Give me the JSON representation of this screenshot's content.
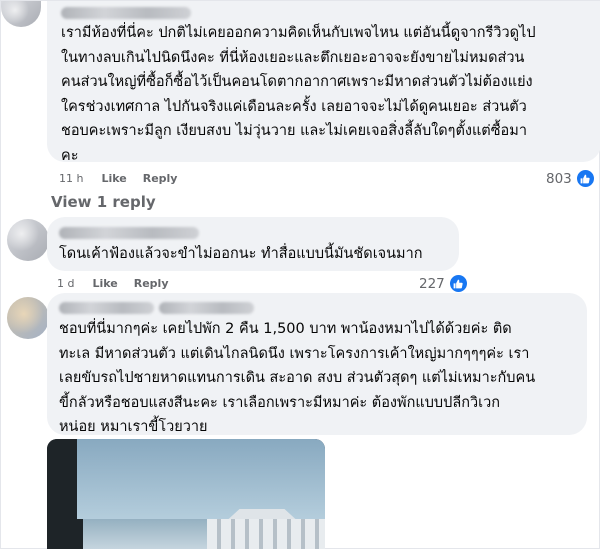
{
  "comments": [
    {
      "text": "เรามีห้องที่นี่คะ ปกติไม่เคยออกความคิดเห็นกับเพจไหน แต่อันนี้ดูจากรีวิวดูไป\nในทางลบเกินไปนิดนึงคะ ที่นี่ห้องเยอะและตึกเยอะอาจจะยังขายไม่หมดส่วน\nคนส่วนใหญ่ที่ซื้อก็ซื้อไว้เป็นคอนโดตากอากาศเพราะมีหาดส่วนตัวไม่ต้องแย่ง\nใครช่วงเทศกาล ไปกันจริงแค่เดือนละครั้ง เลยอาจจะไม่ได้ดูคนเยอะ ส่วนตัว\nชอบคะเพราะมีลูก เงียบสงบ ไม่วุ่นวาย และไม่เคยเจอสิ่งลี้ลับใดๆตั้งแต่ซื้อมา\nคะ",
      "time": "11 h",
      "like_label": "Like",
      "reply_label": "Reply",
      "reactions": "803"
    },
    {
      "text": "โดนเค้าฟ้องแล้วจะขำไม่ออกนะ ทำสื่อแบบนี้มันชัดเจนมาก",
      "time": "1 d",
      "like_label": "Like",
      "reply_label": "Reply",
      "reactions": "227"
    },
    {
      "text": "ชอบที่นี่มากๆค่ะ เคยไปพัก 2 คืน 1,500 บาท พาน้องหมาไปได้ด้วยค่ะ ติด\nทะเล มีหาดส่วนตัว แต่เดินไกลนิดนึง เพราะโครงการเค้าใหญ่มากๆๆๆค่ะ เรา\nเลยขับรถไปชายหาดแทนการเดิน สะอาด สงบ ส่วนตัวสุดๆ แต่ไม่เหมาะกับคน\nขี้กลัวหรือชอบแสงสีนะคะ เราเลือกเพราะมีหมาค่ะ ต้องพักแบบปลีกวิเวก\nหน่อย หมาเราขี้โวยวาย"
    }
  ],
  "view_replies_label": "View 1 reply",
  "colors": {
    "bubble": "#f0f2f5",
    "like_icon": "#1877f2",
    "meta": "#65676b"
  }
}
